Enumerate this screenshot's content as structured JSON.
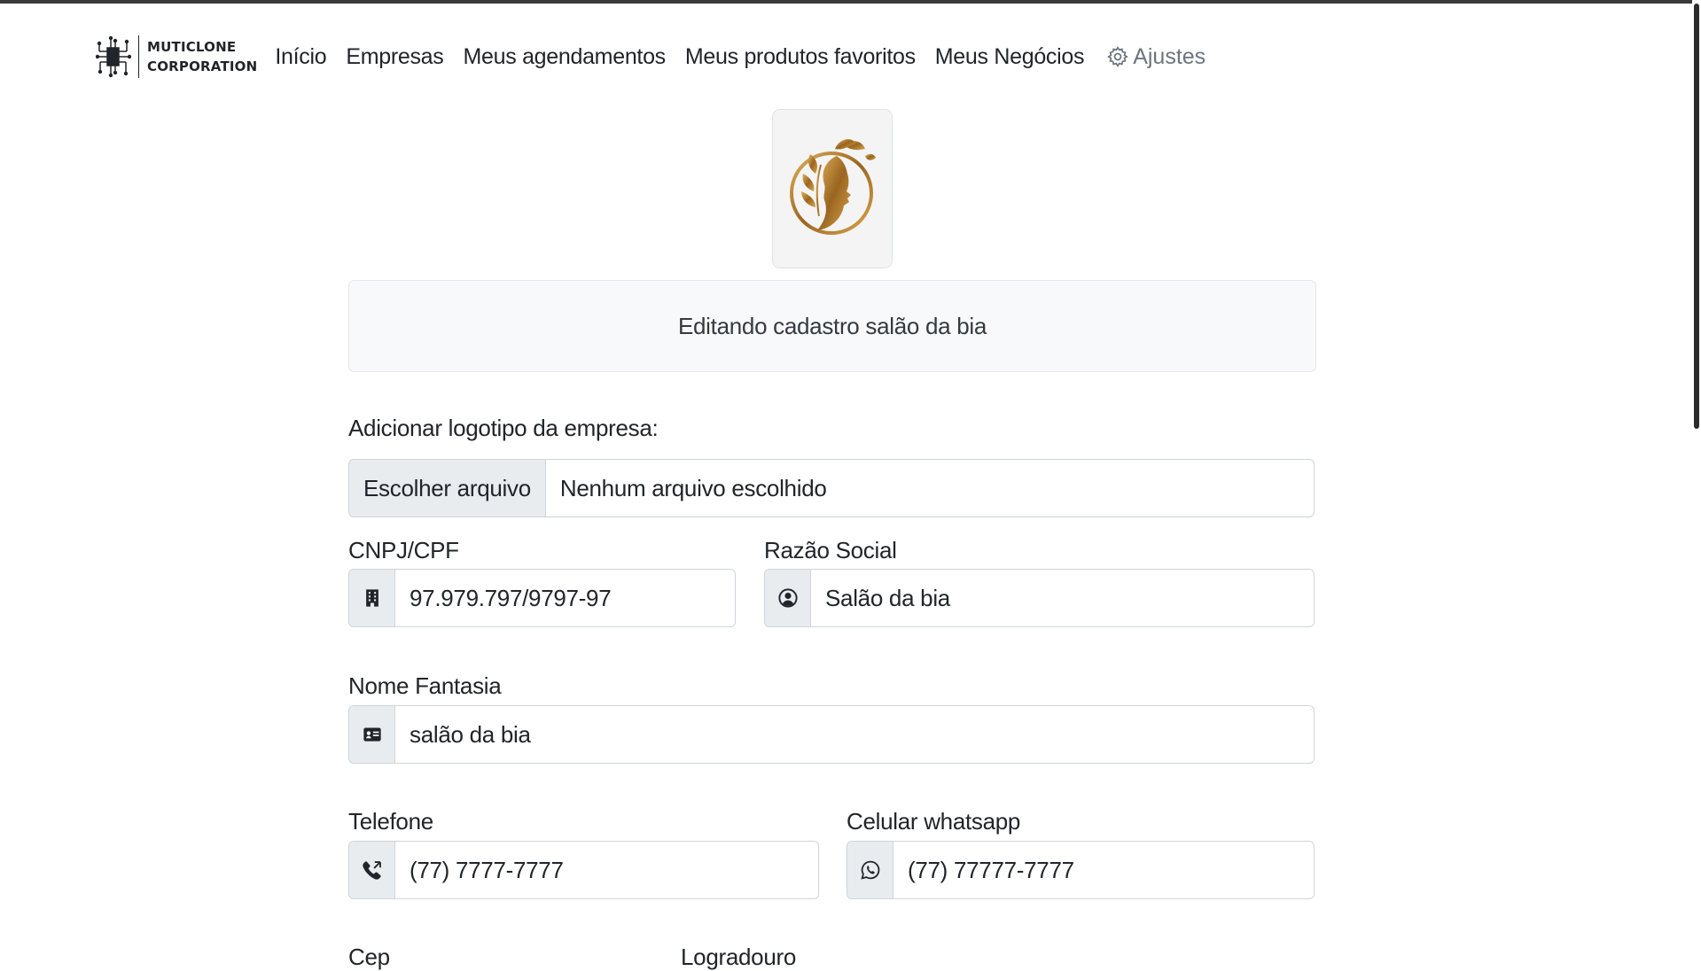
{
  "brand": {
    "line1": "MUTICLONE",
    "line2": "CORPORATION"
  },
  "nav": {
    "links": [
      "Início",
      "Empresas",
      "Meus agendamentos",
      "Meus produtos favoritos",
      "Meus Negócios"
    ],
    "settings_label": "Ajustes",
    "settings_icon": "gear-icon"
  },
  "title": "Editando cadastro salão da bia",
  "logo_upload": {
    "label": "Adicionar logotipo da empresa:",
    "button_label": "Escolher arquivo",
    "file_status": "Nenhum arquivo escolhido"
  },
  "fields": {
    "cnpj": {
      "label": "CNPJ/CPF",
      "value": "97.979.797/9797-97",
      "icon": "building-icon"
    },
    "razao": {
      "label": "Razão Social",
      "value": "Salão da bia",
      "icon": "person-circle-icon"
    },
    "fantasia": {
      "label": "Nome Fantasia",
      "value": "salão da bia",
      "icon": "id-card-icon"
    },
    "telefone": {
      "label": "Telefone",
      "value": "(77) 7777-7777",
      "icon": "phone-icon"
    },
    "celular": {
      "label": "Celular whatsapp",
      "value": "(77) 77777-7777",
      "icon": "whatsapp-icon"
    },
    "cep": {
      "label": "Cep"
    },
    "logradouro": {
      "label": "Logradouro"
    }
  },
  "colors": {
    "text": "#212529",
    "muted": "#6c757d",
    "border": "#ced4da",
    "addon_bg": "#e9ecef",
    "title_bg": "#f8f9fa",
    "logo_gold": "#b8862e"
  }
}
